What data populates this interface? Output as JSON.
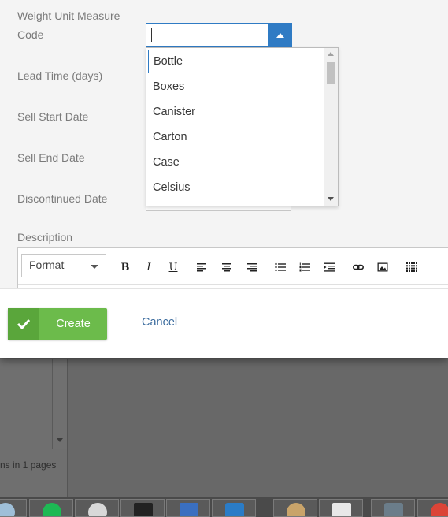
{
  "form": {
    "weight_unit_label_line1": "Weight Unit Measure",
    "weight_unit_label_line2": "Code",
    "lead_time_label": "Lead Time (days)",
    "sell_start_label": "Sell Start Date",
    "sell_end_label": "Sell End Date",
    "discontinued_label": "Discontinued Date",
    "description_label": "Description"
  },
  "dropdown": {
    "options": [
      "Bottle",
      "Boxes",
      "Canister",
      "Carton",
      "Case",
      "Celsius"
    ],
    "selected_index": 0
  },
  "editor": {
    "format_label": "Format",
    "bold": "B",
    "italic": "I",
    "underline": "U"
  },
  "footer": {
    "create_label": "Create",
    "cancel_label": "Cancel"
  },
  "background": {
    "pages_text": "ns in 1 pages"
  },
  "colors": {
    "accent": "#2f7bc4",
    "create_green": "#6cbb4b",
    "cancel_link": "#3d6d9f"
  },
  "taskbar": {
    "icons": [
      "app-icon",
      "spotify-icon",
      "network-icon",
      "hourglass-icon",
      "computer-icon",
      "brackets-icon",
      "paint-icon",
      "vnc-icon",
      "sublime-icon",
      "chrome-icon"
    ]
  }
}
